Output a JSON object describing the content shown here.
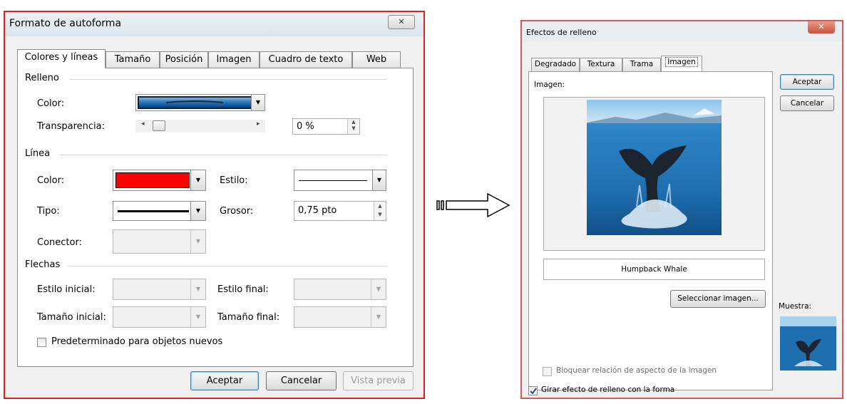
{
  "dialog1": {
    "title": "Formato de autoforma",
    "close": "✕",
    "tabs": [
      "Colores y líneas",
      "Tamaño",
      "Posición",
      "Imagen",
      "Cuadro de texto",
      "Web"
    ],
    "relleno": {
      "heading": "Relleno",
      "color_label": "Color:",
      "transparency_label": "Transparencia:",
      "transparency_value": "0 %",
      "transparency_level": 0
    },
    "linea": {
      "heading": "Línea",
      "color_label": "Color:",
      "color_value": "#ff0000",
      "estilo_label": "Estilo:",
      "tipo_label": "Tipo:",
      "grosor_label": "Grosor:",
      "grosor_value": "0,75 pto",
      "conector_label": "Conector:"
    },
    "flechas": {
      "heading": "Flechas",
      "estilo_inicial_label": "Estilo inicial:",
      "estilo_final_label": "Estilo final:",
      "tamano_inicial_label": "Tamaño inicial:",
      "tamano_final_label": "Tamaño final:"
    },
    "default_checkbox_label": "Predeterminado para objetos nuevos",
    "buttons": {
      "ok": "Aceptar",
      "cancel": "Cancelar",
      "preview": "Vista previa"
    }
  },
  "dialog2": {
    "title": "Efectos de relleno",
    "close": "✕",
    "tabs": [
      "Degradado",
      "Textura",
      "Trama",
      "Imagen"
    ],
    "image_label": "Imagen:",
    "image_name": "Humpback Whale",
    "select_button": "Seleccionar imagen...",
    "lock_checkbox_label": "Bloquear relación de aspecto de la imagen",
    "rotate_checkbox_label": "Girar efecto de relleno con la forma",
    "buttons": {
      "ok": "Aceptar",
      "cancel": "Cancelar"
    },
    "sample_label": "Muestra:"
  },
  "colors": {
    "accent_red": "#e02020",
    "water_blue": "#1f6fb0"
  }
}
